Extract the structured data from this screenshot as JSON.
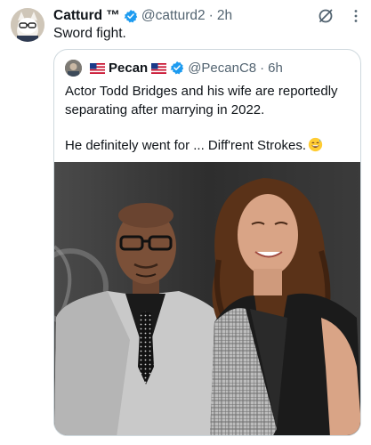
{
  "tweet": {
    "author_name": "Catturd ™",
    "handle": "@catturd2",
    "separator": "·",
    "time": "2h",
    "text": "Sword fight."
  },
  "quoted_tweet": {
    "author_name": "Pecan",
    "handle": "@PecanC8",
    "separator": "·",
    "time": "6h",
    "paragraph_1": "Actor Todd Bridges and his wife are reportedly separating after marrying in 2022.",
    "paragraph_2": "He definitely went for ... Diff'rent Strokes.",
    "emoji": "grinning-sweat-emoji"
  },
  "icons": {
    "verified": "verified-badge-icon",
    "flag": "us-flag-icon",
    "grok": "grok-icon",
    "more": "more-icon"
  },
  "colors": {
    "text_primary": "#0f1419",
    "text_secondary": "#536471",
    "verified_blue": "#1d9bf0",
    "border": "#cfd9de"
  }
}
